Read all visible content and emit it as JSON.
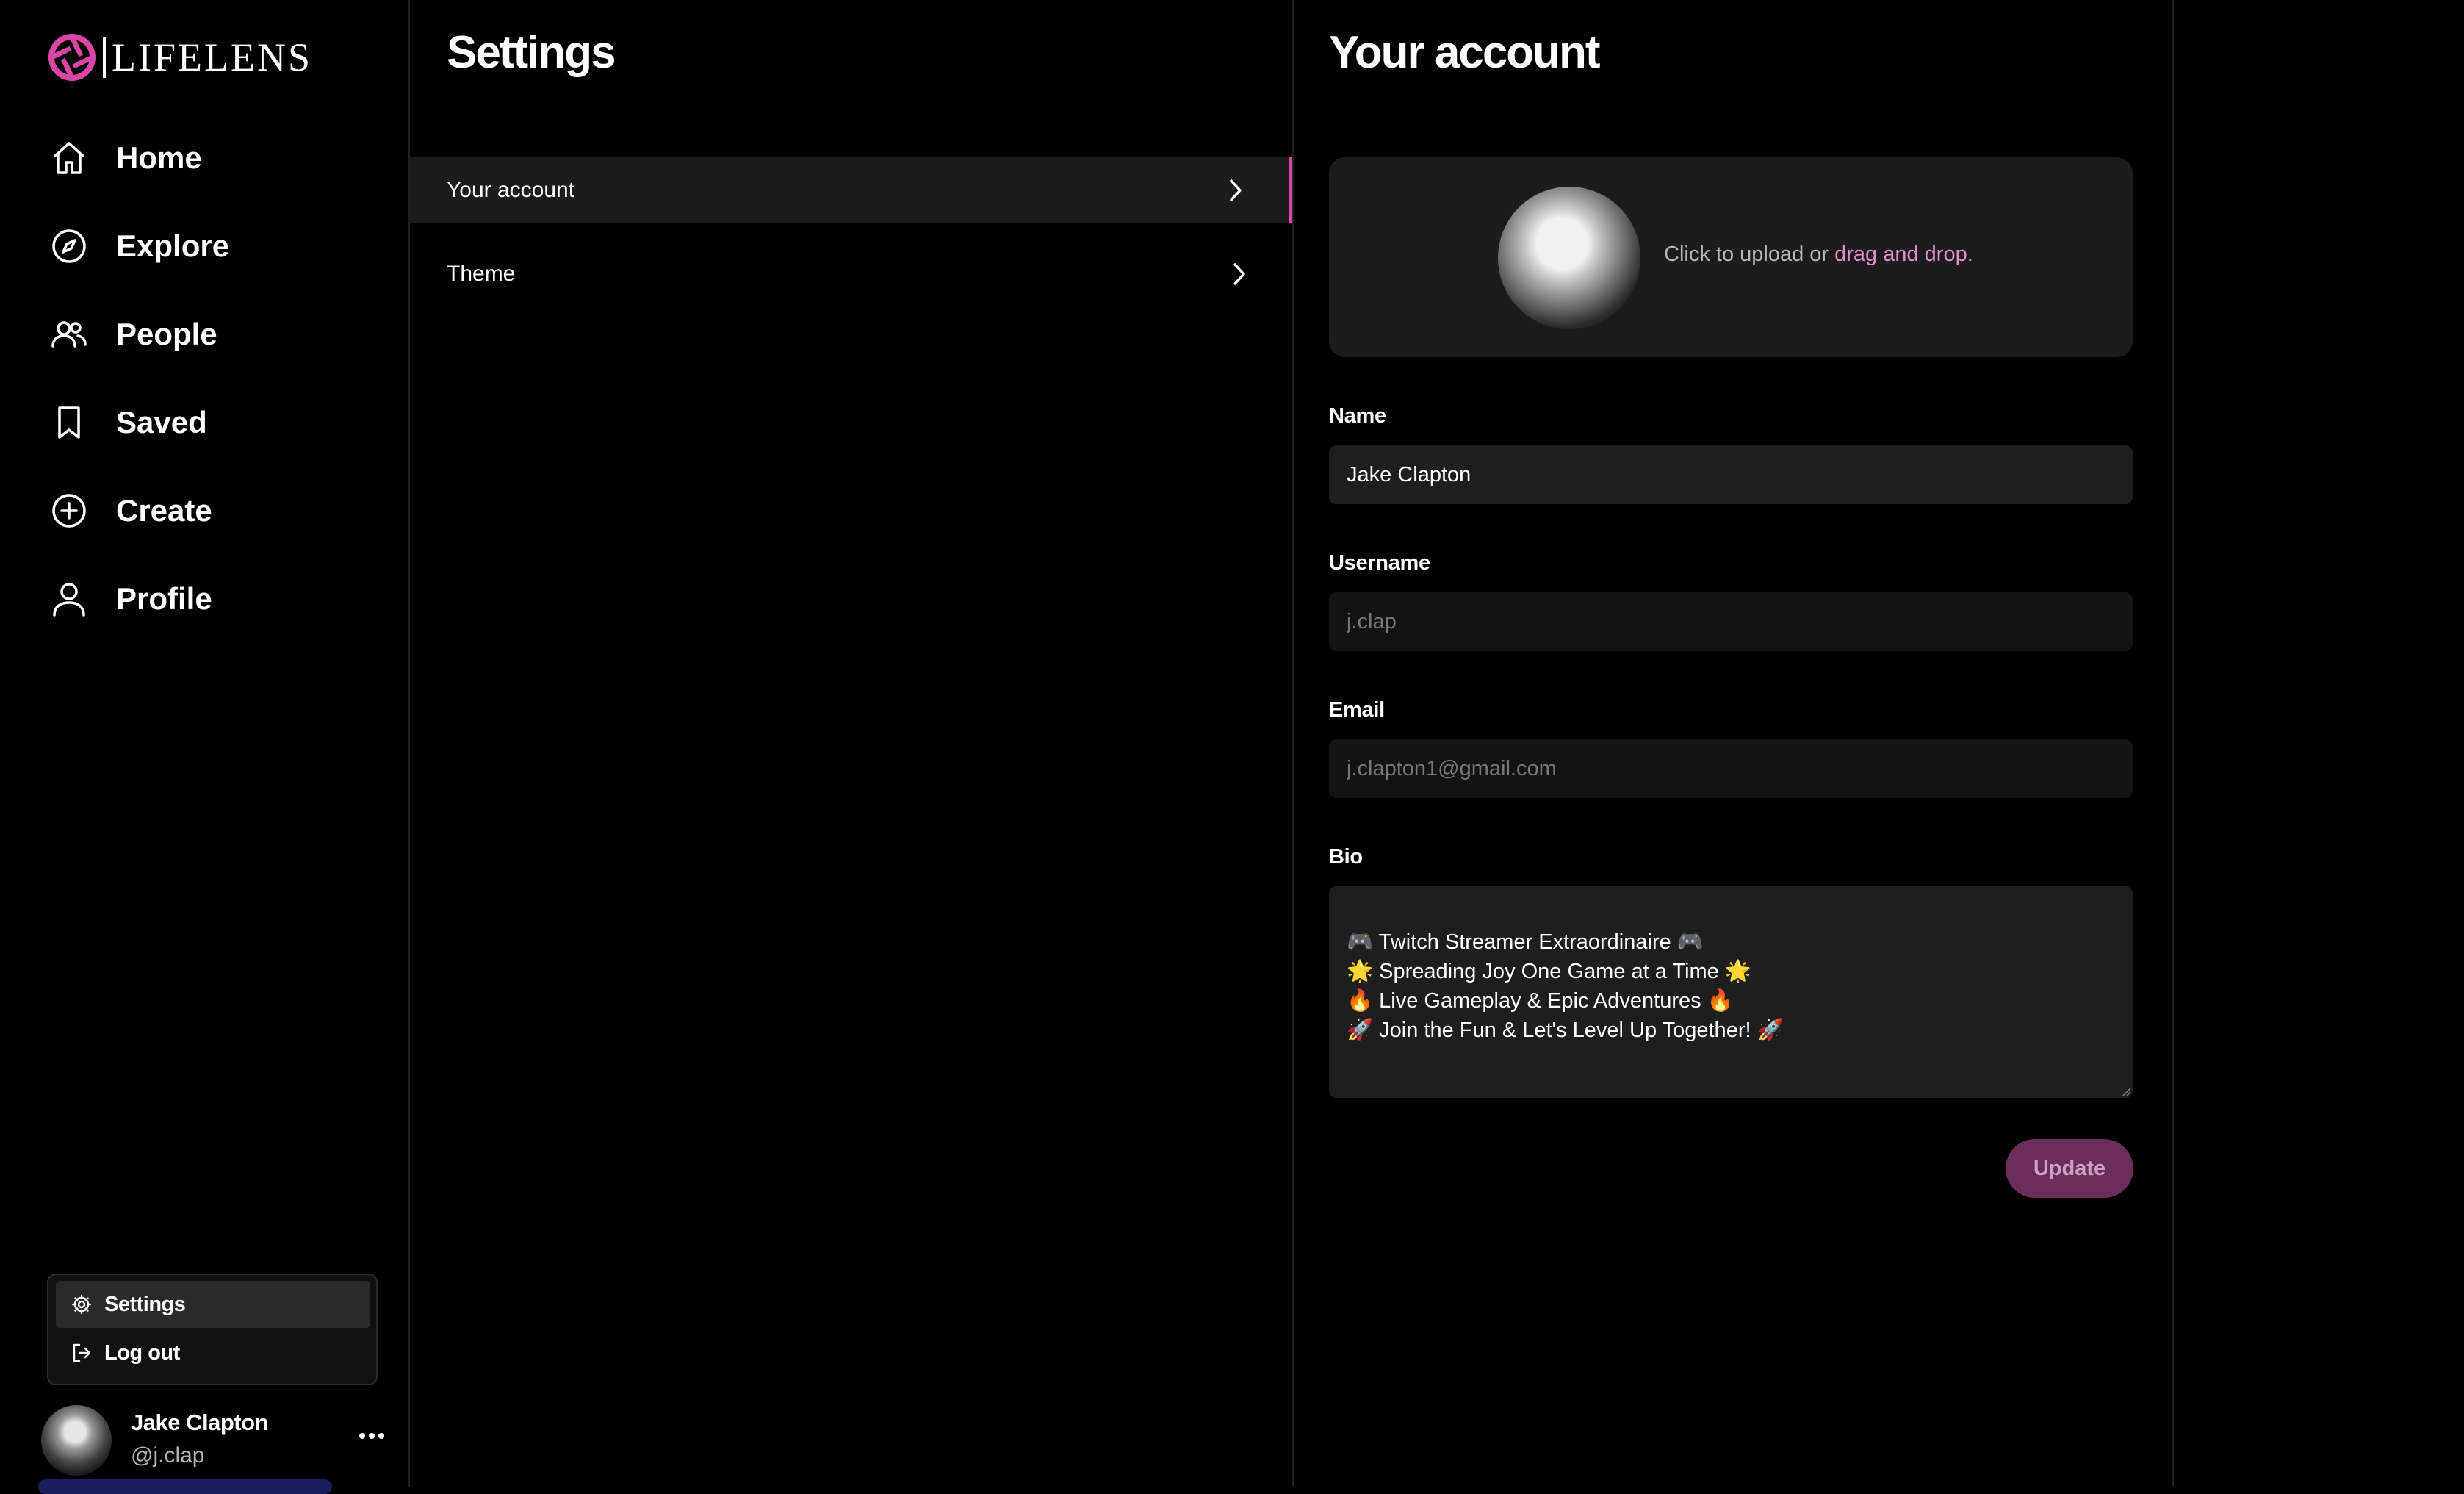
{
  "app": {
    "name": "LIFELENS",
    "accent": "#d946a8"
  },
  "nav": {
    "items": [
      {
        "label": "Home",
        "icon": "home-icon"
      },
      {
        "label": "Explore",
        "icon": "compass-icon"
      },
      {
        "label": "People",
        "icon": "people-icon"
      },
      {
        "label": "Saved",
        "icon": "bookmark-icon"
      },
      {
        "label": "Create",
        "icon": "plus-circle-icon"
      },
      {
        "label": "Profile",
        "icon": "user-icon"
      }
    ]
  },
  "menu_popup": {
    "items": [
      {
        "label": "Settings",
        "icon": "gear-icon",
        "active": true
      },
      {
        "label": "Log out",
        "icon": "logout-icon"
      }
    ]
  },
  "current_user": {
    "name": "Jake Clapton",
    "handle": "@j.clap"
  },
  "settings": {
    "title": "Settings",
    "items": [
      {
        "label": "Your account",
        "active": true
      },
      {
        "label": "Theme"
      }
    ]
  },
  "account": {
    "title": "Your account",
    "upload": {
      "prefix": "Click to upload or ",
      "link": "drag and drop."
    },
    "name": {
      "label": "Name",
      "value": "Jake Clapton"
    },
    "username": {
      "label": "Username",
      "value": "j.clap"
    },
    "email": {
      "label": "Email",
      "value": "j.clapton1@gmail.com"
    },
    "bio": {
      "label": "Bio",
      "value": "🎮 Twitch Streamer Extraordinaire 🎮\n🌟 Spreading Joy One Game at a Time 🌟\n🔥 Live Gameplay & Epic Adventures 🔥\n🚀 Join the Fun & Let's Level Up Together! 🚀"
    },
    "update_label": "Update"
  }
}
